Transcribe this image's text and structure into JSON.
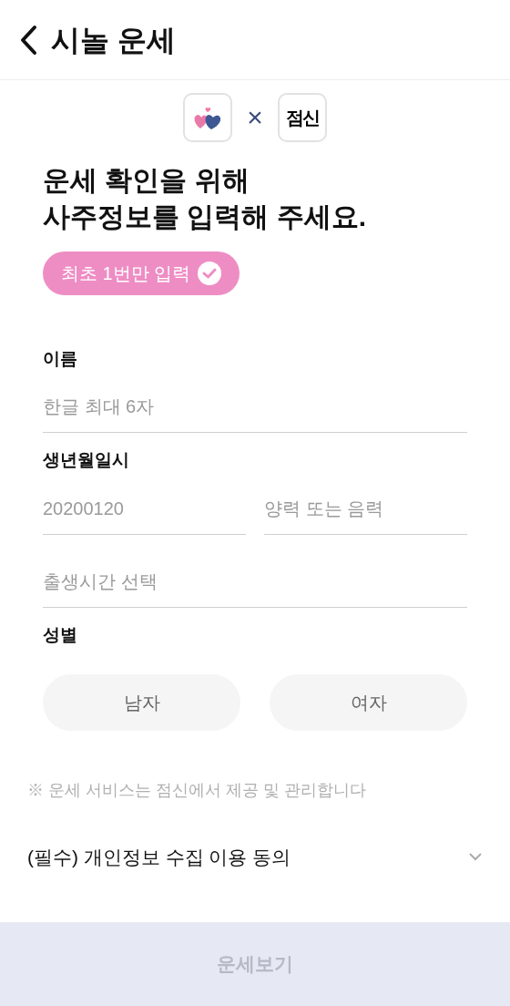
{
  "header": {
    "title": "시놀 운세"
  },
  "partner": {
    "separator": "×",
    "logo_text": "점신"
  },
  "heading": "운세 확인을 위해\n사주정보를 입력해 주세요.",
  "badge": {
    "label": "최초 1번만 입력",
    "checked": true
  },
  "name_section": {
    "label": "이름",
    "field": {
      "placeholder": "한글 최대 6자"
    }
  },
  "birth_section": {
    "label": "생년월일시",
    "date_field": {
      "placeholder": "20200120"
    },
    "calendar_field": {
      "placeholder": "양력 또는 음력"
    },
    "time_field": {
      "placeholder": "출생시간 선택"
    }
  },
  "gender_section": {
    "label": "성별",
    "options": [
      {
        "label": "남자",
        "selected": false
      },
      {
        "label": "여자",
        "selected": false
      }
    ]
  },
  "notice": "※ 운세 서비스는 점신에서 제공 및 관리합니다",
  "agreement": {
    "label": "(필수) 개인정보 수집 이용 동의",
    "expanded": false
  },
  "submit": {
    "label": "운세보기",
    "disabled": true
  }
}
